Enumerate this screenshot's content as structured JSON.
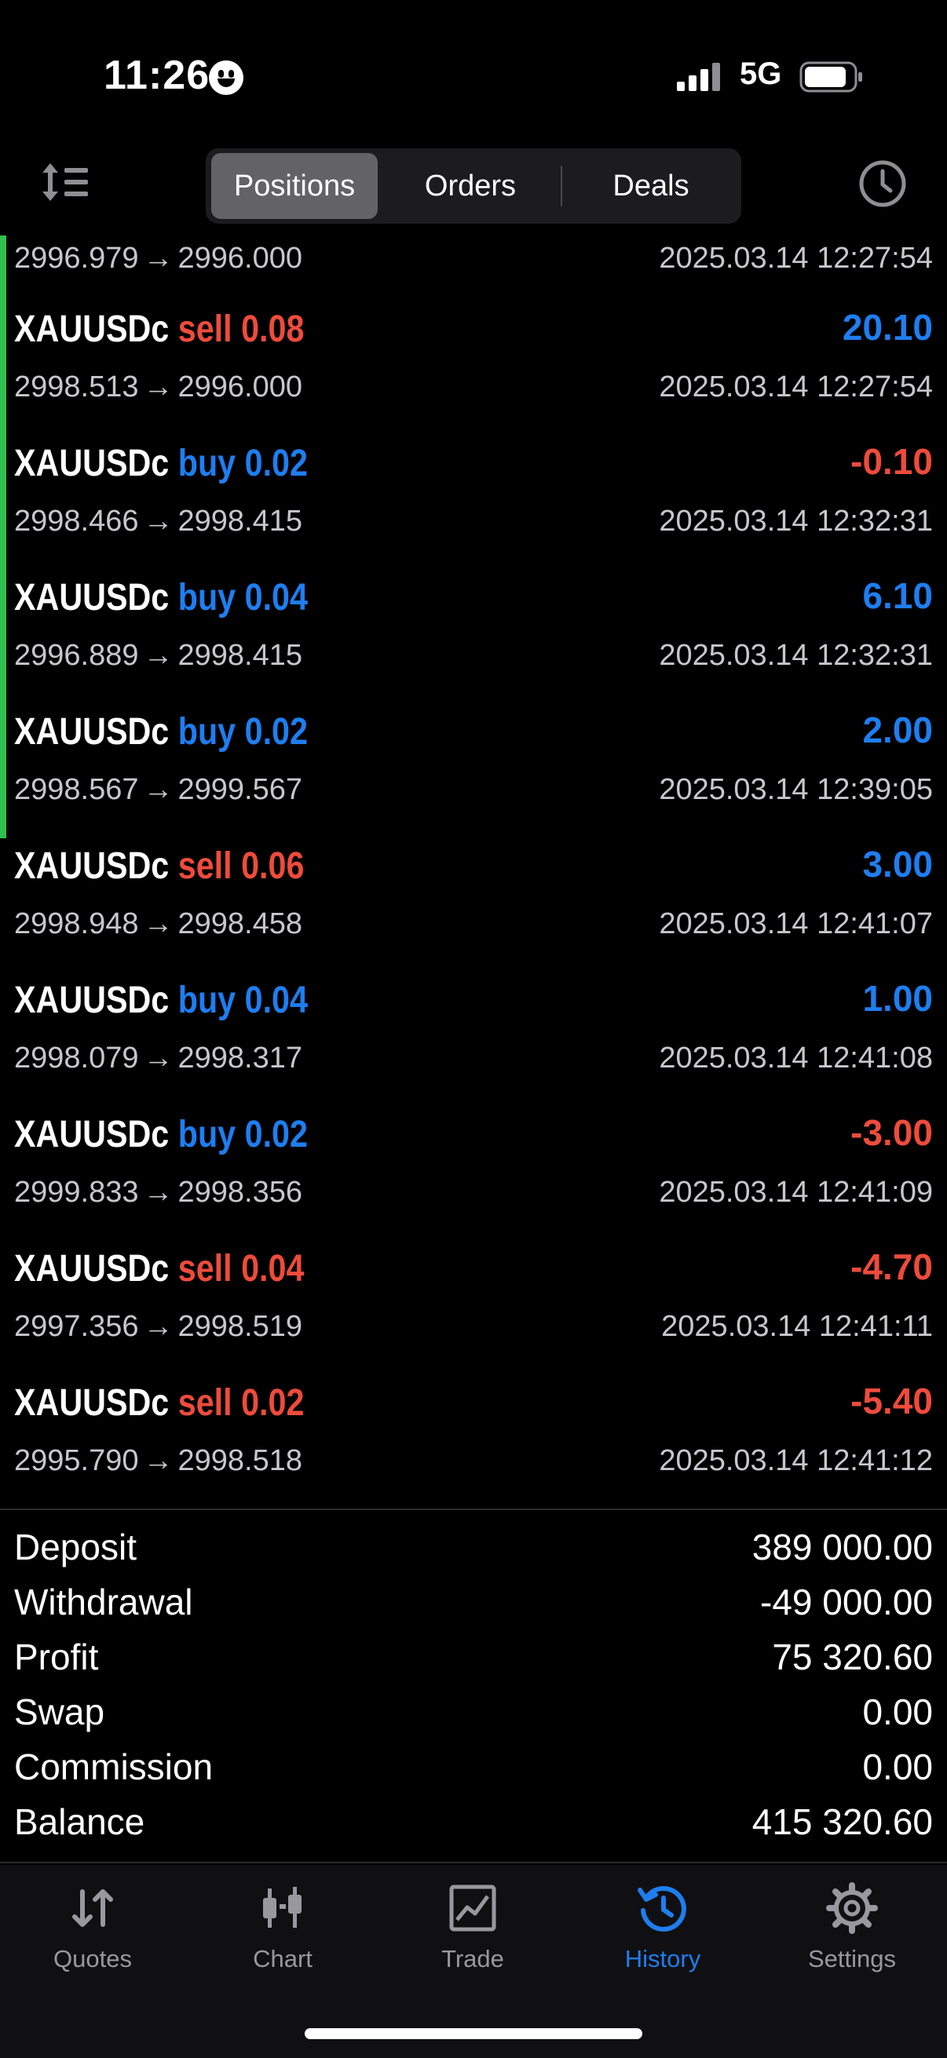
{
  "status_bar": {
    "time": "11:26",
    "network": "5G"
  },
  "segmented_tabs": [
    {
      "label": "Positions",
      "active": true
    },
    {
      "label": "Orders",
      "active": false
    },
    {
      "label": "Deals",
      "active": false
    }
  ],
  "partial_row": {
    "open_price": "2996.979",
    "close_price": "2996.000",
    "datetime": "2025.03.14 12:27:54"
  },
  "deals": [
    {
      "symbol": "XAUUSDc",
      "type": "sell",
      "volume": "0.08",
      "profit": "20.10",
      "open_price": "2998.513",
      "close_price": "2996.000",
      "datetime": "2025.03.14 12:27:54"
    },
    {
      "symbol": "XAUUSDc",
      "type": "buy",
      "volume": "0.02",
      "profit": "-0.10",
      "open_price": "2998.466",
      "close_price": "2998.415",
      "datetime": "2025.03.14 12:32:31"
    },
    {
      "symbol": "XAUUSDc",
      "type": "buy",
      "volume": "0.04",
      "profit": "6.10",
      "open_price": "2996.889",
      "close_price": "2998.415",
      "datetime": "2025.03.14 12:32:31"
    },
    {
      "symbol": "XAUUSDc",
      "type": "buy",
      "volume": "0.02",
      "profit": "2.00",
      "open_price": "2998.567",
      "close_price": "2999.567",
      "datetime": "2025.03.14 12:39:05"
    },
    {
      "symbol": "XAUUSDc",
      "type": "sell",
      "volume": "0.06",
      "profit": "3.00",
      "open_price": "2998.948",
      "close_price": "2998.458",
      "datetime": "2025.03.14 12:41:07"
    },
    {
      "symbol": "XAUUSDc",
      "type": "buy",
      "volume": "0.04",
      "profit": "1.00",
      "open_price": "2998.079",
      "close_price": "2998.317",
      "datetime": "2025.03.14 12:41:08"
    },
    {
      "symbol": "XAUUSDc",
      "type": "buy",
      "volume": "0.02",
      "profit": "-3.00",
      "open_price": "2999.833",
      "close_price": "2998.356",
      "datetime": "2025.03.14 12:41:09"
    },
    {
      "symbol": "XAUUSDc",
      "type": "sell",
      "volume": "0.04",
      "profit": "-4.70",
      "open_price": "2997.356",
      "close_price": "2998.519",
      "datetime": "2025.03.14 12:41:11"
    },
    {
      "symbol": "XAUUSDc",
      "type": "sell",
      "volume": "0.02",
      "profit": "-5.40",
      "open_price": "2995.790",
      "close_price": "2998.518",
      "datetime": "2025.03.14 12:41:12"
    }
  ],
  "summary": [
    {
      "label": "Deposit",
      "value": "389 000.00"
    },
    {
      "label": "Withdrawal",
      "value": "-49 000.00"
    },
    {
      "label": "Profit",
      "value": "75 320.60"
    },
    {
      "label": "Swap",
      "value": "0.00"
    },
    {
      "label": "Commission",
      "value": "0.00"
    },
    {
      "label": "Balance",
      "value": "415 320.60"
    }
  ],
  "tab_bar": [
    {
      "label": "Quotes",
      "icon": "quotes-arrows-icon",
      "active": false
    },
    {
      "label": "Chart",
      "icon": "candlestick-icon",
      "active": false
    },
    {
      "label": "Trade",
      "icon": "trade-chart-icon",
      "active": false
    },
    {
      "label": "History",
      "icon": "history-clock-icon",
      "active": true
    },
    {
      "label": "Settings",
      "icon": "gear-icon",
      "active": false
    }
  ],
  "colors": {
    "buy": "#1e7ef0",
    "sell": "#ee4b3c",
    "active_tab": "#1e7ef0",
    "indicator": "#30c04d"
  }
}
